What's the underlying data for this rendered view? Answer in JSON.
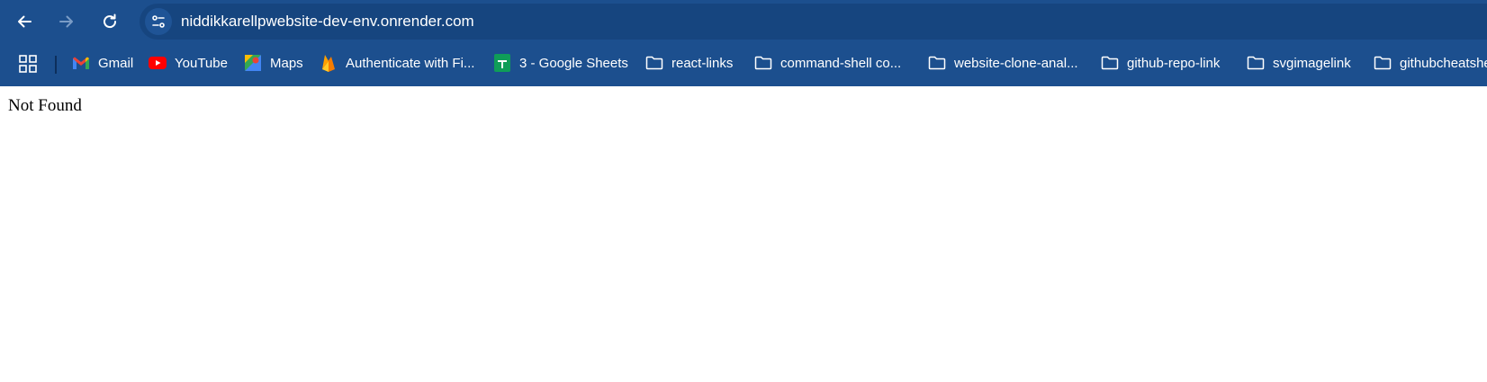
{
  "browser": {
    "url": "niddikkarellpwebsite-dev-env.onrender.com",
    "theme_color": "#1c4f8e"
  },
  "toolbar": {
    "back_icon": "arrow-left-icon",
    "forward_icon": "arrow-right-icon",
    "reload_icon": "reload-icon",
    "site_info_icon": "tune-icon"
  },
  "bookmarks": [
    {
      "label": "Gmail",
      "icon": "gmail-icon"
    },
    {
      "label": "YouTube",
      "icon": "youtube-icon"
    },
    {
      "label": "Maps",
      "icon": "maps-icon"
    },
    {
      "label": "Authenticate with Fi...",
      "icon": "firebase-icon"
    },
    {
      "label": "3 - Google Sheets",
      "icon": "sheets-icon"
    },
    {
      "label": "react-links",
      "icon": "folder-icon"
    },
    {
      "label": "command-shell co...",
      "icon": "folder-icon"
    },
    {
      "label": "website-clone-anal...",
      "icon": "folder-icon"
    },
    {
      "label": "github-repo-link",
      "icon": "folder-icon"
    },
    {
      "label": "svgimagelink",
      "icon": "folder-icon"
    },
    {
      "label": "githubcheatshe",
      "icon": "folder-icon"
    }
  ],
  "page": {
    "message": "Not Found"
  }
}
